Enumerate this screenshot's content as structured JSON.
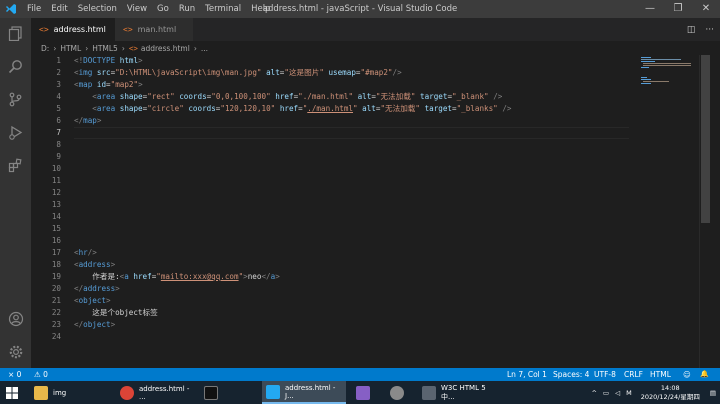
{
  "titlebar": {
    "menus": [
      "File",
      "Edit",
      "Selection",
      "View",
      "Go",
      "Run",
      "Terminal",
      "Help"
    ],
    "window_title": "address.html - javaScript - Visual Studio Code",
    "minimize": "—",
    "maximize": "❐",
    "close": "✕"
  },
  "tabs": [
    {
      "label": "address.html",
      "icon": "<>",
      "close": "✕"
    },
    {
      "label": "man.html",
      "icon": "<>"
    }
  ],
  "tab_actions": {
    "split": "◫",
    "more": "···"
  },
  "breadcrumb": {
    "drive": "D:",
    "folder1": "HTML",
    "folder2": "HTML5",
    "file_icon": "<>",
    "file": "address.html",
    "symbol": "..."
  },
  "editor": {
    "line_numbers": [
      "1",
      "2",
      "3",
      "4",
      "5",
      "6",
      "7",
      "8",
      "9",
      "10",
      "11",
      "12",
      "13",
      "14",
      "15",
      "16",
      "17",
      "18",
      "19",
      "20",
      "21",
      "22",
      "23",
      "24"
    ]
  },
  "code": {
    "l1a": "<!",
    "l1b": "DOCTYPE",
    "l1c": " html",
    "l1d": ">",
    "l2_img_src": "D:\\HTML\\javaScript\\img\\man.jpg",
    "l2_alt": "这是图片",
    "l2_usemap": "#map2",
    "l3_id": "map2",
    "l4_shape": "rect",
    "l4_coords": "0,0,100,100",
    "l4_href": "./man.html",
    "l4_alt": "无法加载",
    "l4_target": "_blank",
    "l5_shape": "circle",
    "l5_coords": "120,120,10",
    "l5_href": "./man.html",
    "l5_alt": "无法加载",
    "l5_target": "_blanks",
    "l20_text": "作者是:",
    "l20_href": "mailto:xxx@qq.com",
    "l20_link": "neo",
    "l22_text": "这是个object标签"
  },
  "statusbar": {
    "remote": "⨯ 0",
    "warnings": "⚠ 0",
    "position": "Ln 7, Col 1",
    "spaces": "Spaces: 4",
    "encoding": "UTF-8",
    "eol": "CRLF",
    "language": "HTML",
    "feedback": "☺",
    "bell": "🔔"
  },
  "taskbar": {
    "items": [
      {
        "label": "img",
        "color": "#e8b84a"
      },
      {
        "label": "address.html - ...",
        "color": "#db4437"
      },
      {
        "label": "",
        "color": "#111111"
      },
      {
        "label": "address.html - J...",
        "color": "#23a9f2"
      },
      {
        "label": "",
        "color": "#865fc5"
      },
      {
        "label": "",
        "color": "#8a8a8a"
      },
      {
        "label": "W3C HTML 5 中...",
        "color": "#5a6470"
      }
    ],
    "time": "14:08",
    "date": "2020/12/24/星期四"
  },
  "colors": {
    "accent": "#007acc",
    "tag": "#569cd6",
    "attr": "#9cdcfe",
    "string": "#ce9178",
    "html_icon": "#e37933"
  }
}
